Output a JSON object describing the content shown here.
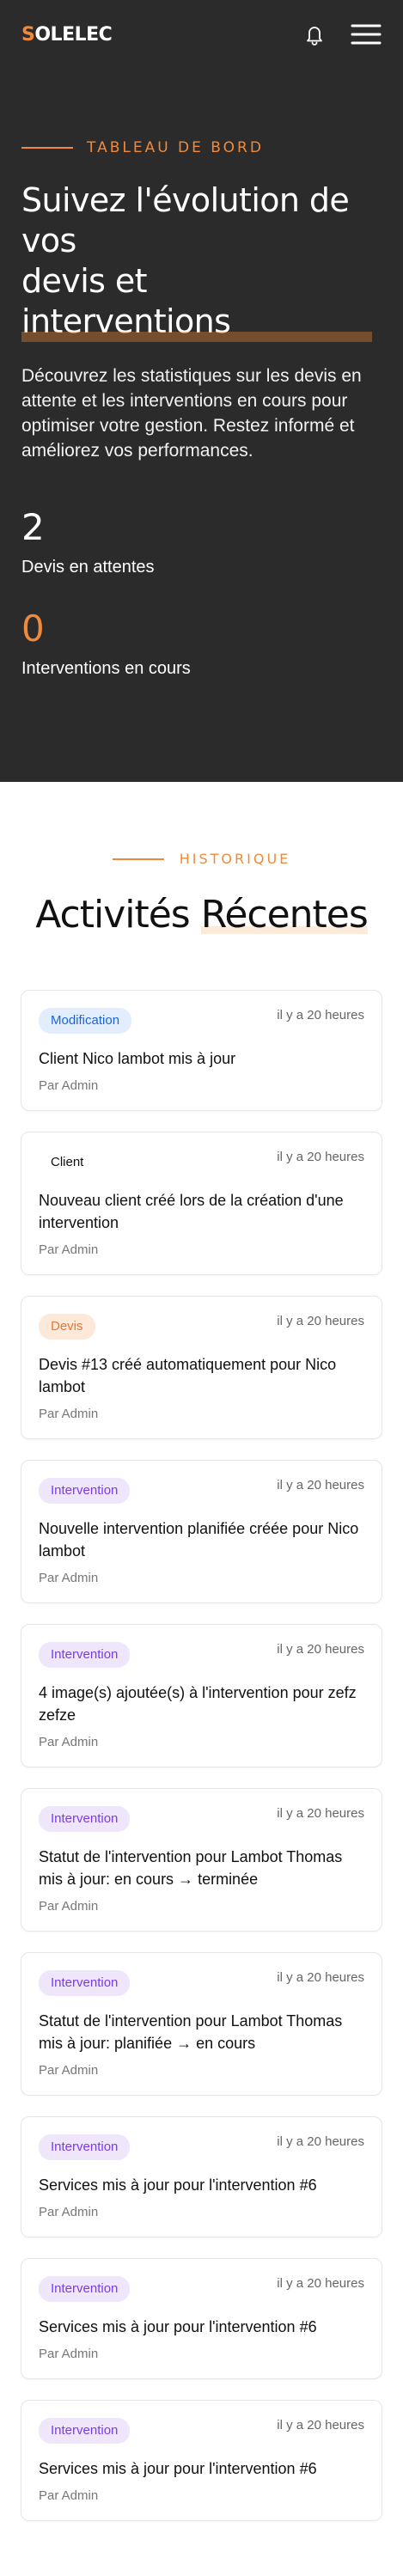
{
  "brand": {
    "logo_accent": "S",
    "logo_rest": "OLELEC",
    "accent_color": "#f08a3a"
  },
  "header": {
    "bell_icon": "bell-icon",
    "menu_icon": "hamburger-menu-icon"
  },
  "hero": {
    "eyebrow": "TABLEAU DE BORD",
    "title_lines": [
      "Suivez l'évolution de vos",
      "devis et",
      "interventions"
    ],
    "description": "Découvrez les statistiques sur les devis en attente et les interventions en cours pour optimiser votre gestion. Restez informé et améliorez vos performances.",
    "stats": [
      {
        "value": "2",
        "label": "Devis en attentes"
      },
      {
        "value": "0",
        "label": "Interventions en cours"
      }
    ]
  },
  "history": {
    "eyebrow": "HISTORIQUE",
    "title_plain": "Activités ",
    "title_highlight": "Récentes",
    "items": [
      {
        "type": "Modification",
        "kind": "modification",
        "time": "il y a 20 heures",
        "message": "Client Nico lambot mis à jour",
        "author": "Par Admin"
      },
      {
        "type": "Client",
        "kind": "client",
        "time": "il y a 20 heures",
        "message": "Nouveau client créé lors de la création d'une intervention",
        "author": "Par Admin"
      },
      {
        "type": "Devis",
        "kind": "devis",
        "time": "il y a 20 heures",
        "message": "Devis #13 créé automatiquement pour Nico lambot",
        "author": "Par Admin"
      },
      {
        "type": "Intervention",
        "kind": "intervention",
        "time": "il y a 20 heures",
        "message": "Nouvelle intervention planifiée créée pour Nico lambot",
        "author": "Par Admin"
      },
      {
        "type": "Intervention",
        "kind": "intervention",
        "time": "il y a 20 heures",
        "message": "4 image(s) ajoutée(s) à l'intervention pour zefz zefze",
        "author": "Par Admin"
      },
      {
        "type": "Intervention",
        "kind": "intervention",
        "time": "il y a 20 heures",
        "message": "Statut de l'intervention pour Lambot Thomas mis à jour: en cours → terminée",
        "author": "Par Admin"
      },
      {
        "type": "Intervention",
        "kind": "intervention",
        "time": "il y a 20 heures",
        "message": "Statut de l'intervention pour Lambot Thomas mis à jour: planifiée → en cours",
        "author": "Par Admin"
      },
      {
        "type": "Intervention",
        "kind": "intervention",
        "time": "il y a 20 heures",
        "message": "Services mis à jour pour l'intervention #6",
        "author": "Par Admin"
      },
      {
        "type": "Intervention",
        "kind": "intervention",
        "time": "il y a 20 heures",
        "message": "Services mis à jour pour l'intervention #6",
        "author": "Par Admin"
      },
      {
        "type": "Intervention",
        "kind": "intervention",
        "time": "il y a 20 heures",
        "message": "Services mis à jour pour l'intervention #6",
        "author": "Par Admin"
      }
    ]
  }
}
